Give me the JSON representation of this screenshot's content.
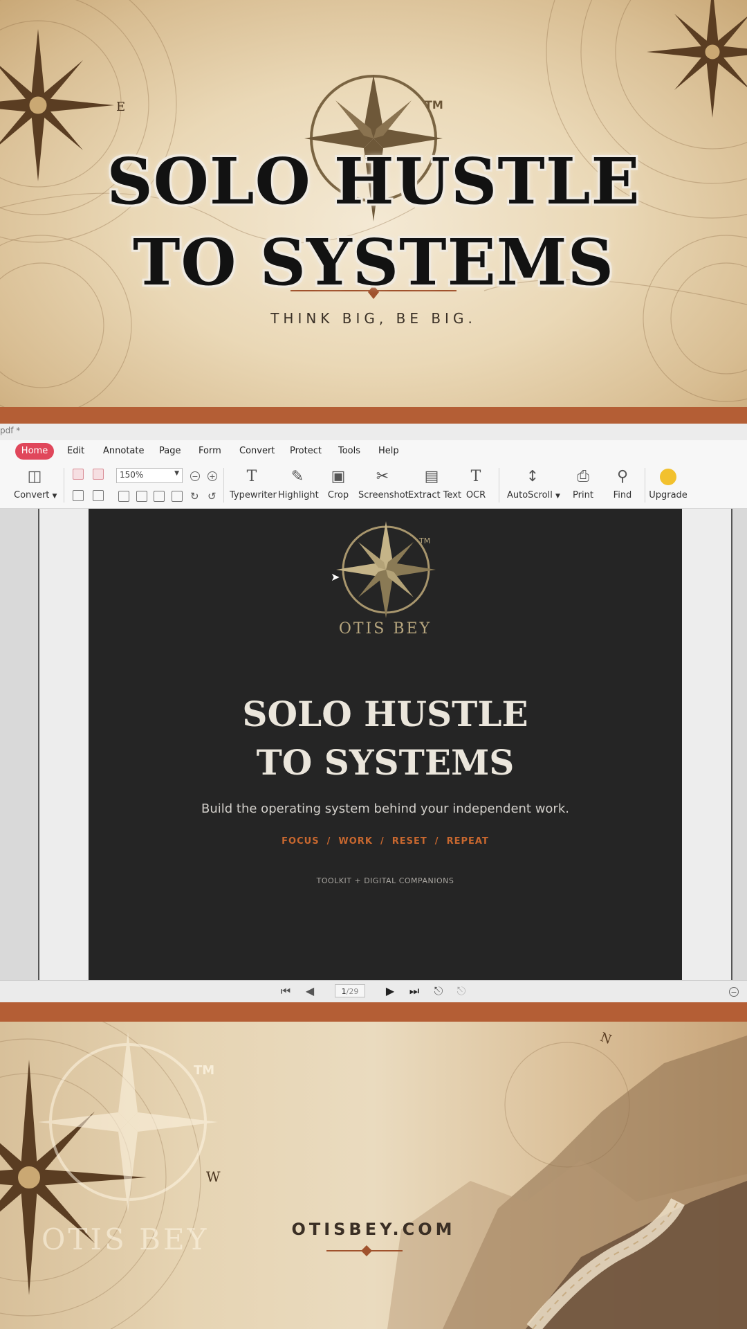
{
  "banner": {
    "title_line1": "SOLO HUSTLE",
    "title_line2": "TO SYSTEMS",
    "tagline": "THINK BIG, BE BIG.",
    "tm": "TM",
    "compass_letter": "E"
  },
  "window": {
    "file_title": "pdf *"
  },
  "menu": {
    "items": [
      "Home",
      "Edit",
      "Annotate",
      "Page",
      "Form",
      "Convert",
      "Protect",
      "Tools",
      "Help"
    ],
    "active": "Home"
  },
  "toolbar": {
    "convert_label": "Convert",
    "zoom_value": "150%",
    "typewriter_label": "Typewriter",
    "highlight_label": "Highlight",
    "crop_label": "Crop",
    "screenshot_label": "Screenshot",
    "extract_text_label": "Extract Text",
    "ocr_label": "OCR",
    "autoscroll_label": "AutoScroll",
    "print_label": "Print",
    "find_label": "Find",
    "upgrade_label": "Upgrade"
  },
  "document": {
    "brand": "OTIS BEY",
    "tm": "TM",
    "title_line1": "SOLO HUSTLE",
    "title_line2": "TO SYSTEMS",
    "subtitle": "Build the operating system behind your independent work.",
    "keywords": "FOCUS  /  WORK  /  RESET  /  REPEAT",
    "footer": "TOOLKIT + DIGITAL COMPANIONS"
  },
  "status": {
    "current_page": "1",
    "total_pages": "/29"
  },
  "bottom_banner": {
    "url": "OTISBEY.COM",
    "brand_watermark": "OTIS BEY",
    "tm": "TM",
    "compass_letter_w": "W",
    "compass_letter_n": "N"
  },
  "colors": {
    "accent_orange": "#b45e35",
    "menu_active": "#e0475b",
    "doc_background": "#252525",
    "keyword_color": "#c9682f",
    "brand_gold": "#b8a77f"
  }
}
